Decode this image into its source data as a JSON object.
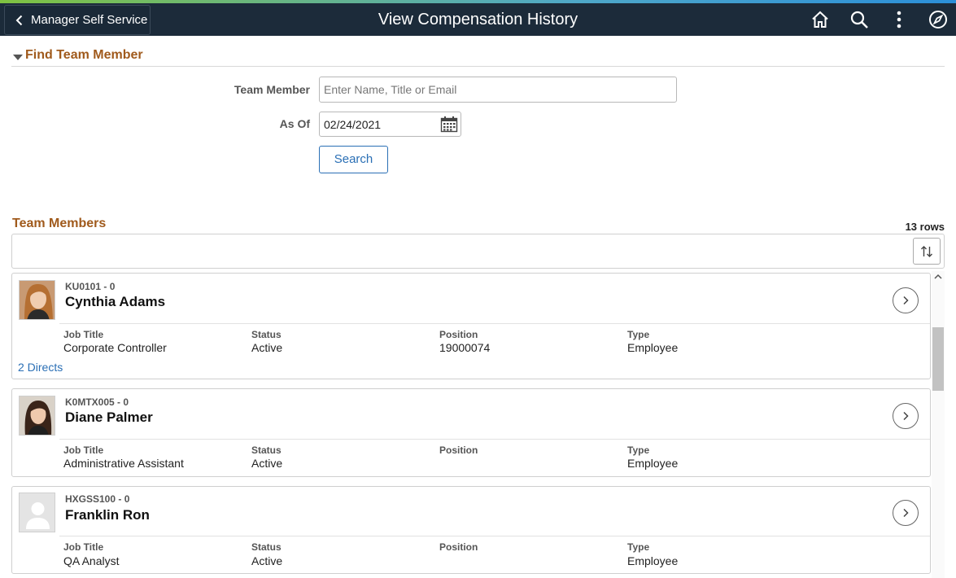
{
  "header": {
    "back_label": "Manager Self Service",
    "title": "View Compensation History"
  },
  "find": {
    "section_title": "Find Team Member",
    "team_member_label": "Team Member",
    "team_member_placeholder": "Enter Name, Title or Email",
    "team_member_value": "",
    "as_of_label": "As Of",
    "as_of_value": "02/24/2021",
    "search_label": "Search"
  },
  "team": {
    "title": "Team Members",
    "row_count": "13 rows",
    "members": [
      {
        "id": "KU0101 - 0",
        "name": "Cynthia Adams",
        "job_title_label": "Job Title",
        "job_title": "Corporate Controller",
        "status_label": "Status",
        "status": "Active",
        "position_label": "Position",
        "position": "19000074",
        "type_label": "Type",
        "type": "Employee",
        "directs": "2 Directs"
      },
      {
        "id": "K0MTX005 - 0",
        "name": "Diane Palmer",
        "job_title_label": "Job Title",
        "job_title": "Administrative Assistant",
        "status_label": "Status",
        "status": "Active",
        "position_label": "Position",
        "position": "",
        "type_label": "Type",
        "type": "Employee"
      },
      {
        "id": "HXGSS100 - 0",
        "name": "Franklin Ron",
        "job_title_label": "Job Title",
        "job_title": "QA Analyst",
        "status_label": "Status",
        "status": "Active",
        "position_label": "Position",
        "position": "",
        "type_label": "Type",
        "type": "Employee"
      }
    ]
  },
  "colors": {
    "header_bg": "#1c2b3a",
    "section_title": "#a05a1c",
    "link": "#2a6fb5"
  },
  "icons": [
    "chevron-left-icon",
    "home-icon",
    "search-icon",
    "more-vertical-icon",
    "navbar-compass-icon",
    "calendar-icon",
    "sort-icon",
    "chevron-right-icon",
    "person-placeholder-icon"
  ]
}
